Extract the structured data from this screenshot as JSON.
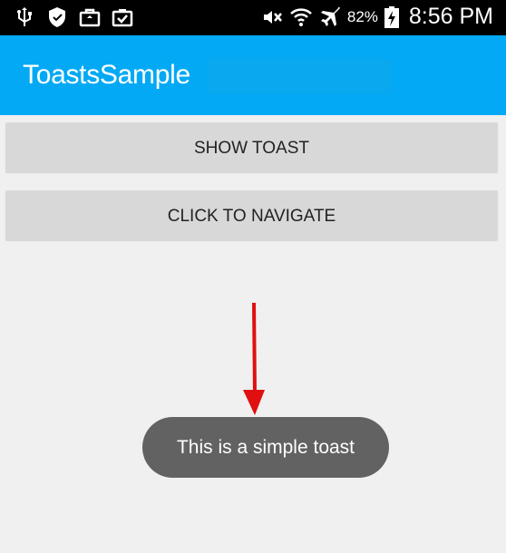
{
  "status_bar": {
    "battery_percent": "82%",
    "time": "8:56 PM",
    "left_icons": [
      "usb-icon",
      "shield-icon",
      "briefcase-icon",
      "clipboard-check-icon"
    ],
    "right_icons": [
      "mute-icon",
      "wifi-icon",
      "airplane-icon",
      "battery-charging-icon"
    ]
  },
  "app_bar": {
    "title": "ToastsSample",
    "color": "#03a9f4"
  },
  "buttons": {
    "show_toast": "SHOW TOAST",
    "navigate": "CLICK TO NAVIGATE"
  },
  "annotation": {
    "icon": "red-arrow-icon",
    "color": "#e01010"
  },
  "toast": {
    "message": "This is a simple toast"
  }
}
